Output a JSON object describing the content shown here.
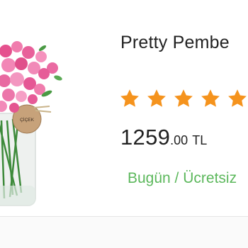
{
  "product": {
    "title": "Pretty Pembe",
    "image_icon": "flower-bouquet-image",
    "tag_text": "ÇİÇEK",
    "rating": {
      "stars": 5,
      "filled": 5,
      "color": "#f5931d"
    },
    "price": {
      "integer": "1259",
      "decimal": ".00",
      "currency": "TL"
    },
    "delivery_text": "Bugün / Ücretsiz"
  },
  "colors": {
    "accent_green": "#5cb85c",
    "star_orange": "#f5931d"
  }
}
